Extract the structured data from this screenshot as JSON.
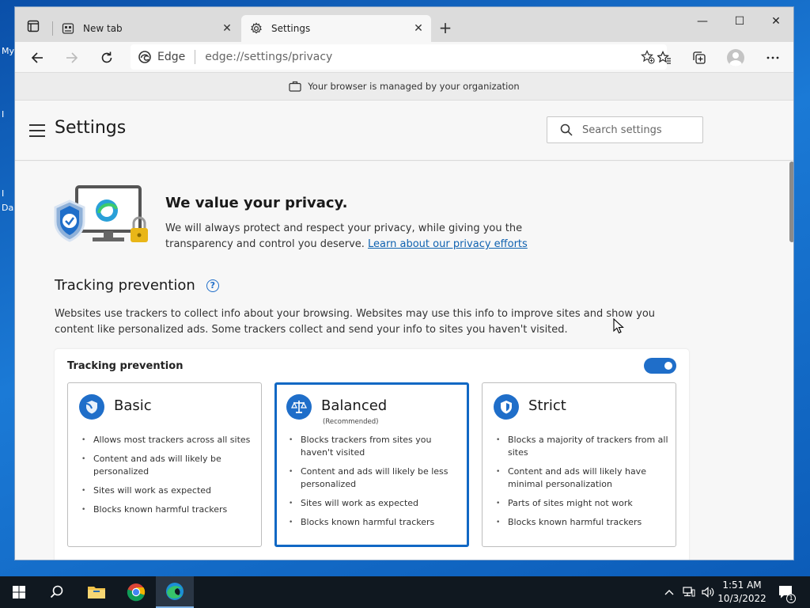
{
  "desktop": {
    "labels": [
      "My",
      "I",
      "I",
      "Da"
    ]
  },
  "tabs": [
    {
      "title": "New tab",
      "active": false
    },
    {
      "title": "Settings",
      "active": true
    }
  ],
  "window_controls": {
    "minimize": "—",
    "maximize": "☐",
    "close": "✕"
  },
  "address_bar": {
    "site": "Edge",
    "url": "edge://settings/privacy"
  },
  "managed_banner": "Your browser is managed by your organization",
  "settings_header": {
    "title": "Settings",
    "search_placeholder": "Search settings"
  },
  "privacy": {
    "title": "We value your privacy.",
    "text": "We will always protect and respect your privacy, while giving you the transparency and control you deserve.",
    "link": "Learn about our privacy efforts"
  },
  "tracking": {
    "heading": "Tracking prevention",
    "help": "?",
    "description": "Websites use trackers to collect info about your browsing. Websites may use this info to improve sites and show you content like personalized ads. Some trackers collect and send your info to sites you haven't visited.",
    "card_title": "Tracking prevention",
    "enabled": true,
    "options": [
      {
        "name": "Basic",
        "subtitle": "",
        "selected": false,
        "icon": "basic-shield-icon",
        "bullets": [
          "Allows most trackers across all sites",
          "Content and ads will likely be personalized",
          "Sites will work as expected",
          "Blocks known harmful trackers"
        ]
      },
      {
        "name": "Balanced",
        "subtitle": "(Recommended)",
        "selected": true,
        "icon": "scale-icon",
        "bullets": [
          "Blocks trackers from sites you haven't visited",
          "Content and ads will likely be less personalized",
          "Sites will work as expected",
          "Blocks known harmful trackers"
        ]
      },
      {
        "name": "Strict",
        "subtitle": "",
        "selected": false,
        "icon": "strict-shield-icon",
        "bullets": [
          "Blocks a majority of trackers from all sites",
          "Content and ads will likely have minimal personalization",
          "Parts of sites might not work",
          "Blocks known harmful trackers"
        ]
      }
    ]
  },
  "taskbar": {
    "clock_time": "1:51 AM",
    "clock_date": "10/3/2022",
    "notification_count": "1"
  },
  "colors": {
    "accent": "#1f6ec9",
    "selected_border": "#1168c4",
    "link": "#0f62b0"
  }
}
